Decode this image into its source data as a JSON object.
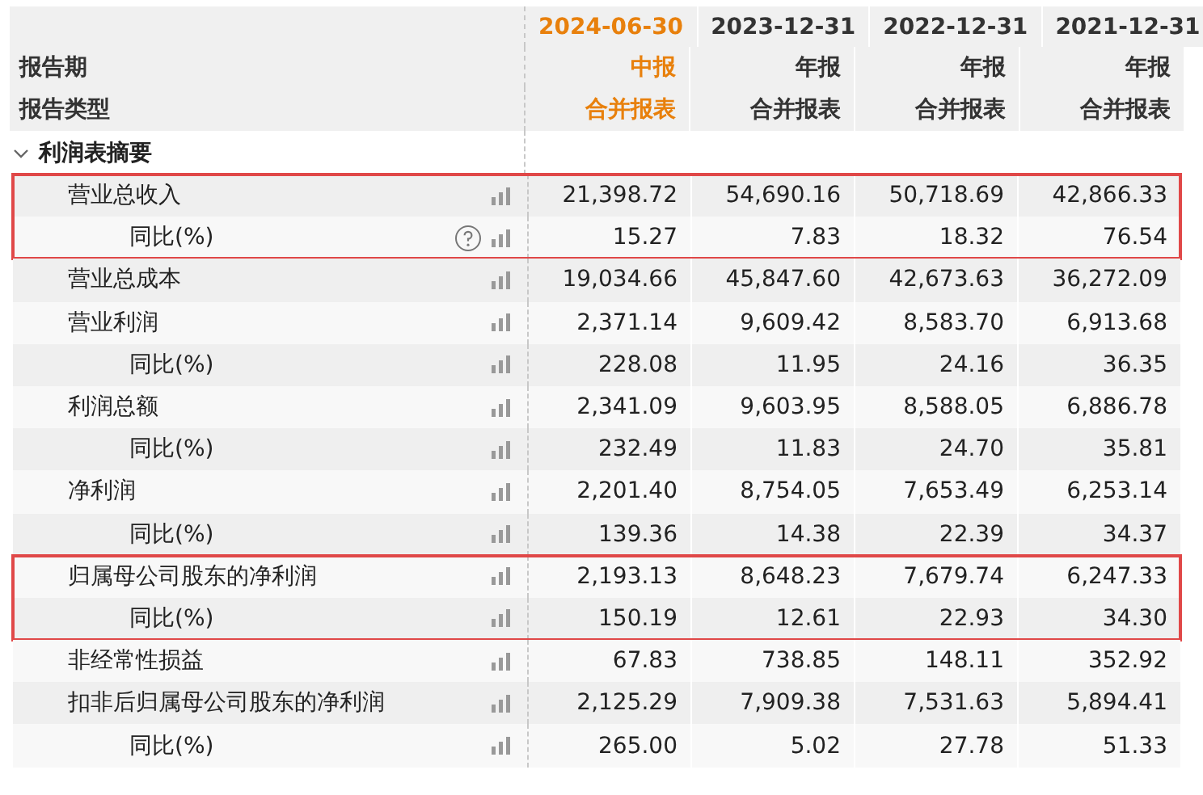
{
  "header": {
    "rows": [
      {
        "label": "",
        "cells": [
          {
            "text": "2024-06-30",
            "selected": true
          },
          {
            "text": "2023-12-31",
            "selected": false
          },
          {
            "text": "2022-12-31",
            "selected": false
          },
          {
            "text": "2021-12-31",
            "selected": false
          }
        ]
      },
      {
        "label": "报告期",
        "cells": [
          {
            "text": "中报",
            "selected": true
          },
          {
            "text": "年报",
            "selected": false
          },
          {
            "text": "年报",
            "selected": false
          },
          {
            "text": "年报",
            "selected": false
          }
        ]
      },
      {
        "label": "报告类型",
        "cells": [
          {
            "text": "合并报表",
            "selected": true
          },
          {
            "text": "合并报表",
            "selected": false
          },
          {
            "text": "合并报表",
            "selected": false
          },
          {
            "text": "合并报表",
            "selected": false
          }
        ]
      }
    ]
  },
  "section": {
    "title": "利润表摘要",
    "expanded": true,
    "items": [
      {
        "label": "营业总收入",
        "values": [
          "21,398.72",
          "54,690.16",
          "50,718.69",
          "42,866.33"
        ],
        "highlighted": true,
        "children": [
          {
            "label": "同比(%)",
            "values": [
              "15.27",
              "7.83",
              "18.32",
              "76.54"
            ],
            "info": true
          }
        ]
      },
      {
        "label": "营业总成本",
        "values": [
          "19,034.66",
          "45,847.60",
          "42,673.63",
          "36,272.09"
        ],
        "highlighted": false
      },
      {
        "label": "营业利润",
        "values": [
          "2,371.14",
          "9,609.42",
          "8,583.70",
          "6,913.68"
        ],
        "highlighted": false,
        "children": [
          {
            "label": "同比(%)",
            "values": [
              "228.08",
              "11.95",
              "24.16",
              "36.35"
            ],
            "info": false
          }
        ]
      },
      {
        "label": "利润总额",
        "values": [
          "2,341.09",
          "9,603.95",
          "8,588.05",
          "6,886.78"
        ],
        "highlighted": false,
        "children": [
          {
            "label": "同比(%)",
            "values": [
              "232.49",
              "11.83",
              "24.70",
              "35.81"
            ],
            "info": false
          }
        ]
      },
      {
        "label": "净利润",
        "values": [
          "2,201.40",
          "8,754.05",
          "7,653.49",
          "6,253.14"
        ],
        "highlighted": false,
        "children": [
          {
            "label": "同比(%)",
            "values": [
              "139.36",
              "14.38",
              "22.39",
              "34.37"
            ],
            "info": false
          }
        ]
      },
      {
        "label": "归属母公司股东的净利润",
        "values": [
          "2,193.13",
          "8,648.23",
          "7,679.74",
          "6,247.33"
        ],
        "highlighted": true,
        "children": [
          {
            "label": "同比(%)",
            "values": [
              "150.19",
              "12.61",
              "22.93",
              "34.30"
            ],
            "info": false
          }
        ]
      },
      {
        "label": "非经常性损益",
        "values": [
          "67.83",
          "738.85",
          "148.11",
          "352.92"
        ],
        "highlighted": false
      },
      {
        "label": "扣非后归属母公司股东的净利润",
        "values": [
          "2,125.29",
          "7,909.38",
          "7,531.63",
          "5,894.41"
        ],
        "highlighted": false,
        "children": [
          {
            "label": "同比(%)",
            "values": [
              "265.00",
              "5.02",
              "27.78",
              "51.33"
            ],
            "info": false
          }
        ]
      }
    ]
  }
}
